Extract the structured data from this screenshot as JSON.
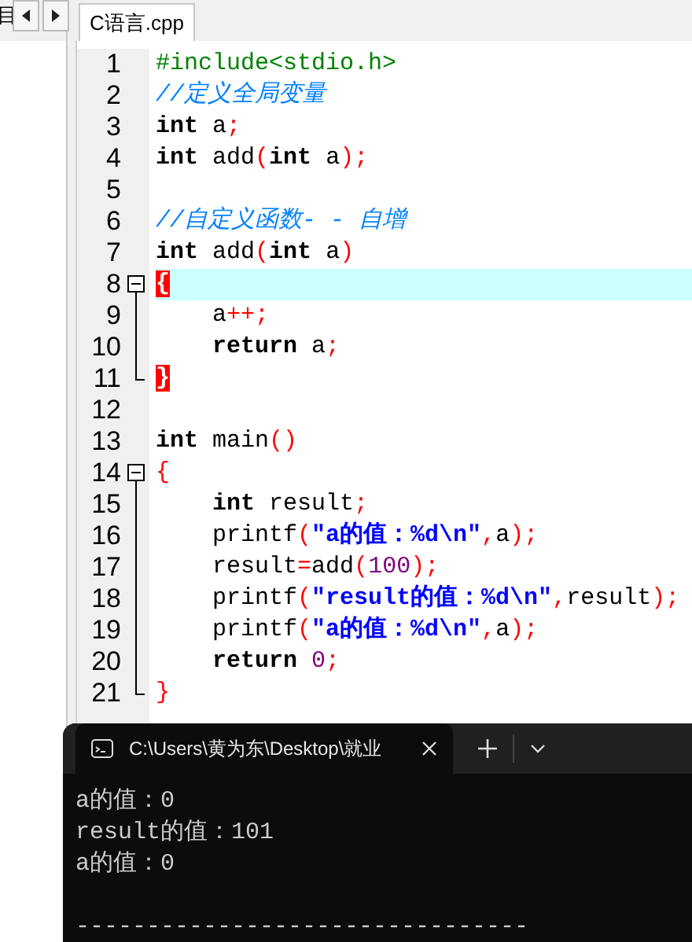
{
  "left_panel": {
    "label": "目"
  },
  "editor": {
    "tabs": [
      {
        "label": "C语言.cpp",
        "selected": true
      }
    ],
    "lines": [
      {
        "number": "1",
        "kind": "plain",
        "tokens": [
          {
            "kind": "pre",
            "text": "#include<stdio.h>"
          }
        ]
      },
      {
        "number": "2",
        "kind": "plain",
        "tokens": [
          {
            "kind": "comment",
            "text": "//定义全局变量"
          }
        ]
      },
      {
        "number": "3",
        "kind": "plain",
        "tokens": [
          {
            "kind": "kw",
            "text": "int"
          },
          {
            "kind": "plain",
            "text": " a"
          },
          {
            "kind": "punct",
            "text": ";"
          }
        ]
      },
      {
        "number": "4",
        "kind": "plain",
        "tokens": [
          {
            "kind": "kw",
            "text": "int"
          },
          {
            "kind": "plain",
            "text": " add"
          },
          {
            "kind": "punct",
            "text": "("
          },
          {
            "kind": "kw",
            "text": "int"
          },
          {
            "kind": "plain",
            "text": " a"
          },
          {
            "kind": "punct",
            "text": ");"
          }
        ]
      },
      {
        "number": "5",
        "kind": "plain"
      },
      {
        "number": "6",
        "kind": "plain",
        "tokens": [
          {
            "kind": "comment",
            "text": "//自定义函数- - 自增"
          }
        ]
      },
      {
        "number": "7",
        "kind": "plain",
        "tokens": [
          {
            "kind": "kw",
            "text": "int"
          },
          {
            "kind": "plain",
            "text": " add"
          },
          {
            "kind": "punct",
            "text": "("
          },
          {
            "kind": "kw",
            "text": "int"
          },
          {
            "kind": "plain",
            "text": " a"
          },
          {
            "kind": "punct",
            "text": ")"
          }
        ]
      },
      {
        "number": "8",
        "current": true,
        "kind": "fold_start",
        "tokens": [
          {
            "kind": "brace_match",
            "text": "{"
          }
        ]
      },
      {
        "number": "9",
        "kind": "fold_body",
        "tokens": [
          {
            "kind": "plain",
            "text": "    a"
          },
          {
            "kind": "punct",
            "text": "++;"
          }
        ]
      },
      {
        "number": "10",
        "kind": "fold_body",
        "tokens": [
          {
            "kind": "kw",
            "text": "    return"
          },
          {
            "kind": "plain",
            "text": " a"
          },
          {
            "kind": "punct",
            "text": ";"
          }
        ]
      },
      {
        "number": "11",
        "kind": "fold_end",
        "tokens": [
          {
            "kind": "brace_match",
            "text": "}"
          }
        ]
      },
      {
        "number": "12",
        "kind": "plain"
      },
      {
        "number": "13",
        "kind": "plain",
        "tokens": [
          {
            "kind": "kw",
            "text": "int"
          },
          {
            "kind": "plain",
            "text": " main"
          },
          {
            "kind": "punct",
            "text": "()"
          }
        ]
      },
      {
        "number": "14",
        "kind": "fold_start",
        "tokens": [
          {
            "kind": "punct",
            "text": "{"
          }
        ]
      },
      {
        "number": "15",
        "kind": "fold_body",
        "tokens": [
          {
            "kind": "kw",
            "text": "    int"
          },
          {
            "kind": "plain",
            "text": " result"
          },
          {
            "kind": "punct",
            "text": ";"
          }
        ]
      },
      {
        "number": "16",
        "kind": "fold_body",
        "tokens": [
          {
            "kind": "plain",
            "text": "    printf"
          },
          {
            "kind": "punct",
            "text": "("
          },
          {
            "kind": "str",
            "text": "\"a的值：%d\\n\""
          },
          {
            "kind": "punct",
            "text": ","
          },
          {
            "kind": "plain",
            "text": "a"
          },
          {
            "kind": "punct",
            "text": ");"
          }
        ]
      },
      {
        "number": "17",
        "kind": "fold_body",
        "tokens": [
          {
            "kind": "plain",
            "text": "    result"
          },
          {
            "kind": "punct",
            "text": "="
          },
          {
            "kind": "plain",
            "text": "add"
          },
          {
            "kind": "punct",
            "text": "("
          },
          {
            "kind": "num",
            "text": "100"
          },
          {
            "kind": "punct",
            "text": ");"
          }
        ]
      },
      {
        "number": "18",
        "kind": "fold_body",
        "tokens": [
          {
            "kind": "plain",
            "text": "    printf"
          },
          {
            "kind": "punct",
            "text": "("
          },
          {
            "kind": "str",
            "text": "\"result的值：%d\\n\""
          },
          {
            "kind": "punct",
            "text": ","
          },
          {
            "kind": "plain",
            "text": "result"
          },
          {
            "kind": "punct",
            "text": ");"
          }
        ]
      },
      {
        "number": "19",
        "kind": "fold_body",
        "tokens": [
          {
            "kind": "plain",
            "text": "    printf"
          },
          {
            "kind": "punct",
            "text": "("
          },
          {
            "kind": "str",
            "text": "\"a的值：%d\\n\""
          },
          {
            "kind": "punct",
            "text": ","
          },
          {
            "kind": "plain",
            "text": "a"
          },
          {
            "kind": "punct",
            "text": ");"
          }
        ]
      },
      {
        "number": "20",
        "kind": "fold_body",
        "tokens": [
          {
            "kind": "kw",
            "text": "    return"
          },
          {
            "kind": "num",
            "text": " 0"
          },
          {
            "kind": "punct",
            "text": ";"
          }
        ]
      },
      {
        "number": "21",
        "kind": "fold_end",
        "tokens": [
          {
            "kind": "punct",
            "text": "}"
          }
        ]
      }
    ]
  },
  "terminal": {
    "tab_title": "C:\\Users\\黄为东\\Desktop\\就业",
    "output": [
      "a的值：0",
      "result的值：101",
      "a的值：0"
    ],
    "separator": "--------------------------------"
  }
}
